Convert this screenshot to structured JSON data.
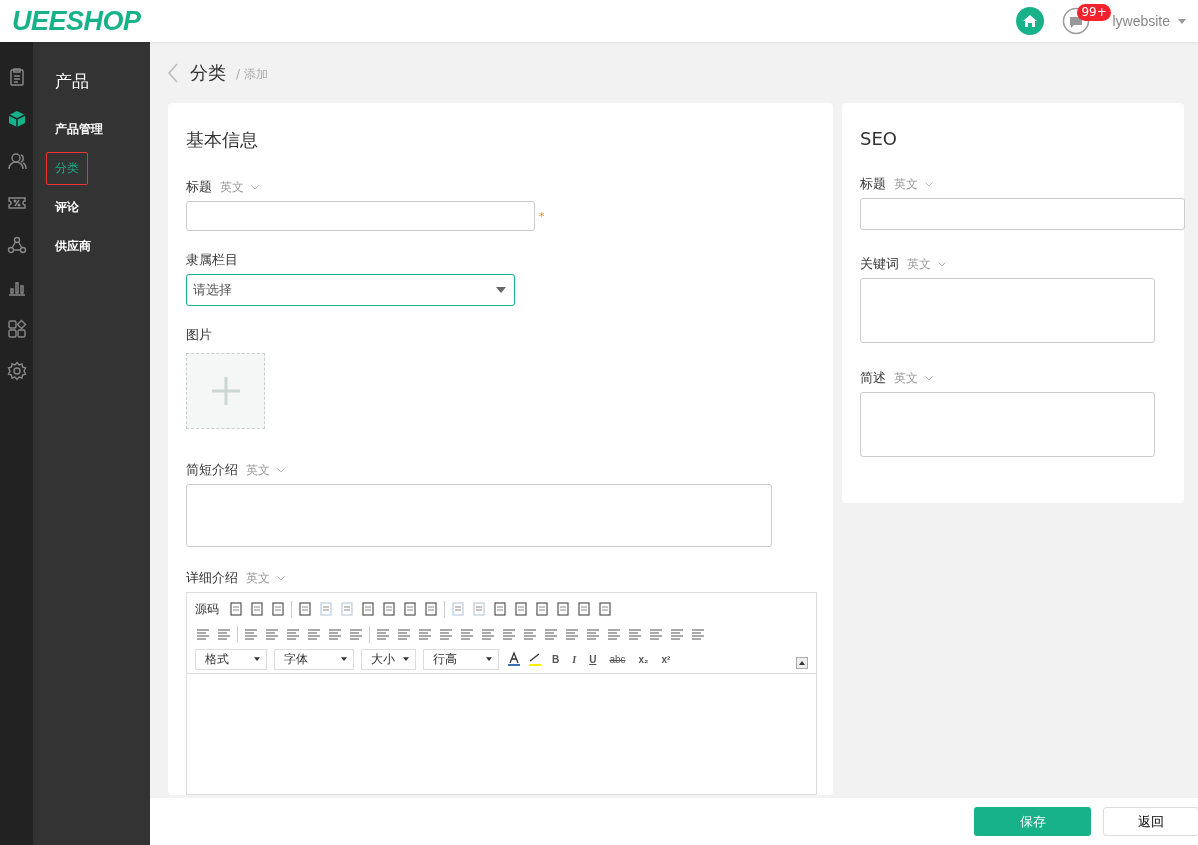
{
  "header": {
    "logo": "UEESHOP",
    "notifications": "99+",
    "user": "lywebsite"
  },
  "rail": [
    {
      "kind": "clipboard",
      "selected": false
    },
    {
      "kind": "cube",
      "selected": true
    },
    {
      "kind": "user",
      "selected": false
    },
    {
      "kind": "coupon",
      "selected": false
    },
    {
      "kind": "network",
      "selected": false
    },
    {
      "kind": "chart",
      "selected": false
    },
    {
      "kind": "apps",
      "selected": false
    },
    {
      "kind": "gear",
      "selected": false
    }
  ],
  "sidebar": {
    "title": "产品",
    "items": [
      {
        "label": "产品管理",
        "selected": false
      },
      {
        "label": "分类",
        "selected": true
      },
      {
        "label": "评论",
        "selected": false
      },
      {
        "label": "供应商",
        "selected": false
      }
    ]
  },
  "breadcrumb": {
    "current": "分类",
    "sub": "/ 添加"
  },
  "basic": {
    "title": "基本信息",
    "title_field": {
      "label": "标题",
      "lang": "英文",
      "required": "*"
    },
    "parent": {
      "label": "隶属栏目",
      "placeholder": "请选择"
    },
    "image": {
      "label": "图片"
    },
    "brief": {
      "label": "简短介绍",
      "lang": "英文"
    },
    "detail": {
      "label": "详细介绍",
      "lang": "英文",
      "source": "源码",
      "dropdowns": [
        "格式",
        "字体",
        "大小",
        "行高"
      ],
      "format_buttons": [
        "B",
        "I",
        "U",
        "abc",
        "x₂",
        "x²"
      ]
    }
  },
  "seo": {
    "title": "SEO",
    "fields": [
      {
        "kind": "input",
        "label": "标题",
        "lang": "英文"
      },
      {
        "kind": "textarea",
        "label": "关键词",
        "lang": "英文"
      },
      {
        "kind": "textarea",
        "label": "简述",
        "lang": "英文"
      }
    ]
  },
  "buttons": {
    "save": "保存",
    "back": "返回"
  }
}
